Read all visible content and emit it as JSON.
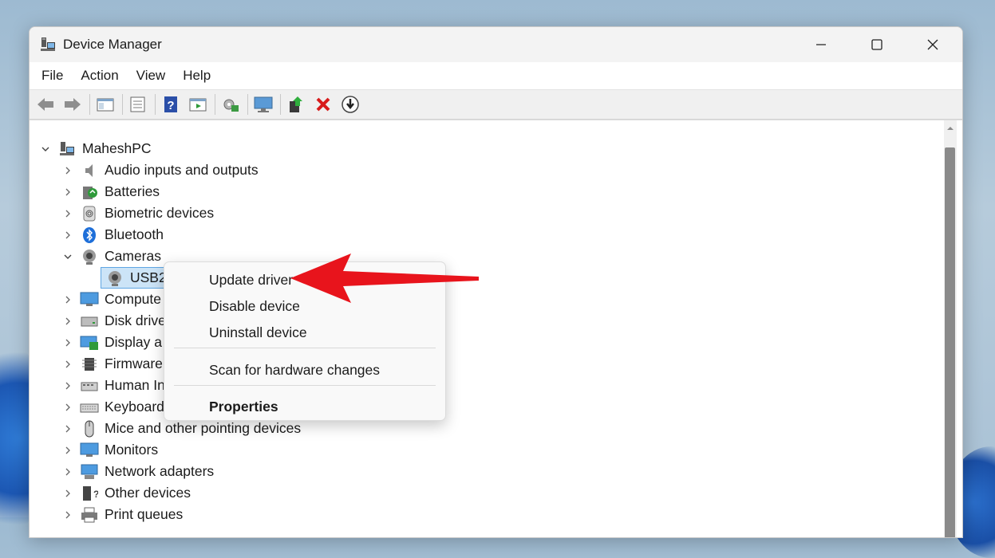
{
  "window": {
    "title": "Device Manager",
    "controls": [
      "minimize-icon",
      "maximize-icon",
      "close-icon"
    ]
  },
  "menubar": {
    "items": [
      "File",
      "Action",
      "View",
      "Help"
    ]
  },
  "toolbar": {
    "icons": [
      "back-icon",
      "forward-icon",
      "show-hide-console-tree-icon",
      "properties-icon",
      "help-icon",
      "action-pane-icon",
      "update-driver-icon",
      "scan-hardware-icon",
      "enable-device-icon",
      "uninstall-device-icon",
      "disable-device-icon"
    ]
  },
  "tree": {
    "root": "MaheshPC",
    "categories": [
      {
        "label": "Audio inputs and outputs",
        "icon": "speaker-icon",
        "expanded": false
      },
      {
        "label": "Batteries",
        "icon": "battery-icon",
        "expanded": false
      },
      {
        "label": "Biometric devices",
        "icon": "fingerprint-icon",
        "expanded": false
      },
      {
        "label": "Bluetooth",
        "icon": "bluetooth-icon",
        "expanded": false
      },
      {
        "label": "Cameras",
        "icon": "camera-icon",
        "expanded": true
      },
      {
        "label": "USB2.",
        "icon": "webcam-icon",
        "child": true,
        "selected": true
      },
      {
        "label": "Compute",
        "icon": "computer-icon",
        "expanded": false
      },
      {
        "label": "Disk drive",
        "icon": "disk-drive-icon",
        "expanded": false
      },
      {
        "label": "Display a",
        "icon": "display-adapter-icon",
        "expanded": false
      },
      {
        "label": "Firmware",
        "icon": "firmware-icon",
        "expanded": false
      },
      {
        "label": "Human In",
        "icon": "hid-icon",
        "expanded": false
      },
      {
        "label": "Keyboard",
        "icon": "keyboard-icon",
        "expanded": false
      },
      {
        "label": "Mice and other pointing devices",
        "icon": "mouse-icon",
        "expanded": false
      },
      {
        "label": "Monitors",
        "icon": "monitor-icon",
        "expanded": false
      },
      {
        "label": "Network adapters",
        "icon": "network-adapter-icon",
        "expanded": false
      },
      {
        "label": "Other devices",
        "icon": "other-devices-icon",
        "expanded": false
      },
      {
        "label": "Print queues",
        "icon": "printer-icon",
        "expanded": false
      }
    ]
  },
  "context_menu": {
    "items": [
      "Update driver",
      "Disable device",
      "Uninstall device",
      "Scan for hardware changes",
      "Properties"
    ],
    "default_item": "Properties"
  },
  "annotation": {
    "arrow_color": "#e8141c"
  }
}
